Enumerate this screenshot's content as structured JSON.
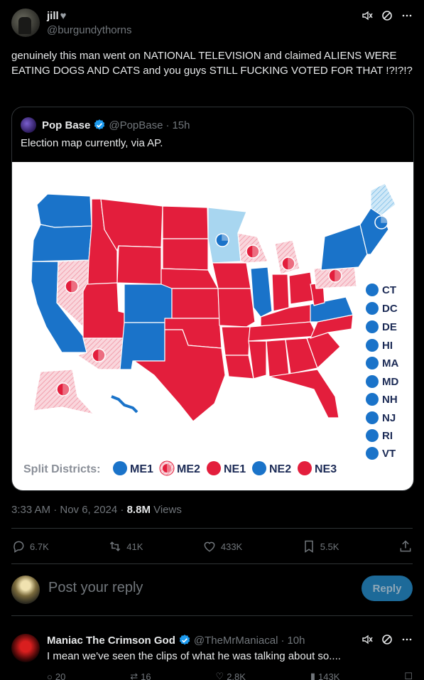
{
  "post": {
    "display_name": "jill",
    "handle": "@burgundythorns",
    "text": "genuinely this man went on NATIONAL TELEVISION and claimed ALIENS WERE EATING DOGS AND CATS  and you guys STILL FUCKING VOTED FOR THAT !?!?!?",
    "timestamp": "3:33 AM · Nov 6, 2024 · ",
    "views_count": "8.8M",
    "views_label": " Views"
  },
  "quote": {
    "display_name": "Pop Base",
    "handle": "@PopBase",
    "time": "15h",
    "text": "Election map currently, via AP."
  },
  "map": {
    "colors": {
      "dem": "#1a73c9",
      "rep": "#e31e3c",
      "lean_rep": "#f6c6cf",
      "lean_dem": "#a8d6f0"
    },
    "dc_states": [
      "CT",
      "DC",
      "DE",
      "HI",
      "MA",
      "MD",
      "NH",
      "NJ",
      "RI",
      "VT"
    ],
    "split_label": "Split Districts:",
    "split_districts": [
      {
        "label": "ME1",
        "party": "dem"
      },
      {
        "label": "ME2",
        "party": "pending"
      },
      {
        "label": "NE1",
        "party": "rep"
      },
      {
        "label": "NE2",
        "party": "dem"
      },
      {
        "label": "NE3",
        "party": "rep"
      }
    ]
  },
  "actions": {
    "replies": "6.7K",
    "reposts": "41K",
    "likes": "433K",
    "bookmarks": "5.5K"
  },
  "reply_box": {
    "placeholder": "Post your reply",
    "button": "Reply"
  },
  "reply": {
    "display_name": "Maniac The Crimson God",
    "handle": "@TheMrManiacal",
    "time": "10h",
    "text": "I mean we've seen the clips of what he was talking about so....",
    "replies": "20",
    "reposts": "16",
    "likes": "2.8K",
    "views": "143K"
  }
}
